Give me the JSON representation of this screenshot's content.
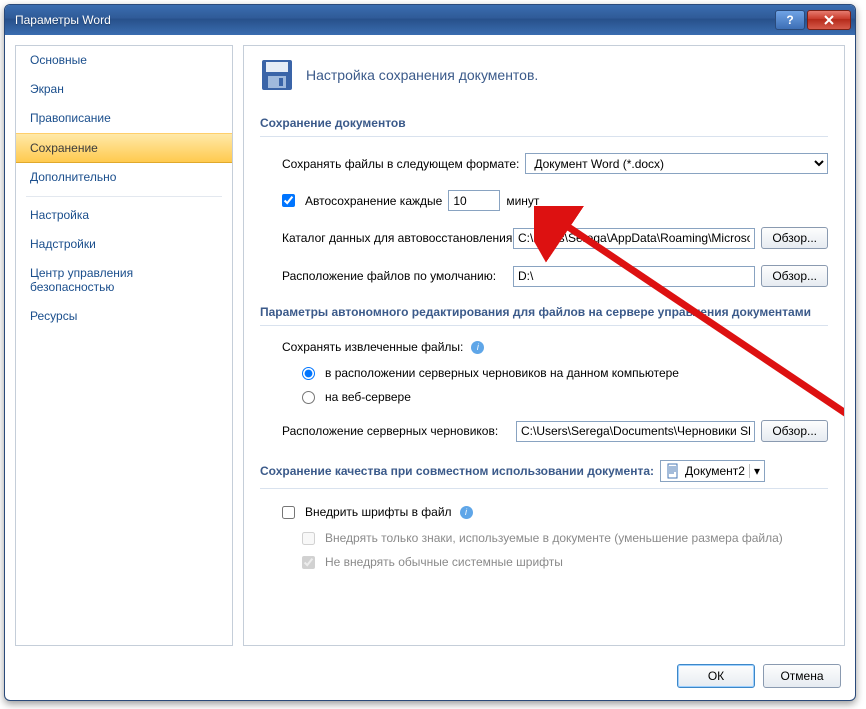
{
  "window": {
    "title": "Параметры Word"
  },
  "sidebar": {
    "items": [
      {
        "label": "Основные"
      },
      {
        "label": "Экран"
      },
      {
        "label": "Правописание"
      },
      {
        "label": "Сохранение",
        "selected": true
      },
      {
        "label": "Дополнительно"
      },
      {
        "label": "Настройка"
      },
      {
        "label": "Надстройки"
      },
      {
        "label": "Центр управления безопасностью"
      },
      {
        "label": "Ресурсы"
      }
    ]
  },
  "header": {
    "title": "Настройка сохранения документов."
  },
  "sections": {
    "save_docs": "Сохранение документов",
    "offline": "Параметры автономного редактирования для файлов на сервере управления документами",
    "fidelity_prefix": "Сохранение качества при совместном использовании документа:"
  },
  "save": {
    "format_label": "Сохранять файлы в следующем формате:",
    "format_value": "Документ Word (*.docx)",
    "autosave_label": "Автосохранение каждые",
    "autosave_value": "10",
    "autosave_unit": "минут",
    "autorecover_label": "Каталог данных для автовосстановления:",
    "autorecover_value": "C:\\Users\\Serega\\AppData\\Roaming\\Microsoft",
    "default_loc_label": "Расположение файлов по умолчанию:",
    "default_loc_value": "D:\\",
    "browse": "Обзор..."
  },
  "offline": {
    "save_checked_label": "Сохранять извлеченные файлы:",
    "opt_local": "в расположении серверных черновиков на данном компьютере",
    "opt_web": "на веб-сервере",
    "drafts_label": "Расположение серверных черновиков:",
    "drafts_value": "C:\\Users\\Serega\\Documents\\Черновики Share",
    "browse": "Обзор..."
  },
  "fidelity": {
    "doc_name": "Документ2",
    "embed_label": "Внедрить шрифты в файл",
    "embed_sub1": "Внедрять только знаки, используемые в документе (уменьшение размера файла)",
    "embed_sub2": "Не внедрять обычные системные шрифты"
  },
  "footer": {
    "ok": "ОК",
    "cancel": "Отмена"
  }
}
